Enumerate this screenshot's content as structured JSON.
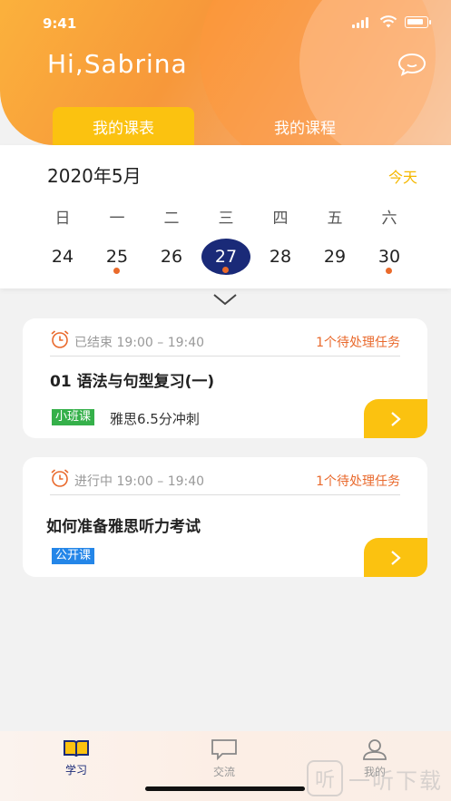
{
  "status_bar": {
    "time": "9:41"
  },
  "header": {
    "greeting": "Hi,Sabrina"
  },
  "tabs": [
    {
      "label": "我的课表",
      "active": true
    },
    {
      "label": "我的课程",
      "active": false
    }
  ],
  "calendar": {
    "month_title": "2020年5月",
    "today_label": "今天",
    "weekdays": [
      "日",
      "一",
      "二",
      "三",
      "四",
      "五",
      "六"
    ],
    "days": [
      {
        "num": "24",
        "has_dot": false,
        "selected": false
      },
      {
        "num": "25",
        "has_dot": true,
        "selected": false
      },
      {
        "num": "26",
        "has_dot": false,
        "selected": false
      },
      {
        "num": "27",
        "has_dot": true,
        "selected": true
      },
      {
        "num": "28",
        "has_dot": false,
        "selected": false
      },
      {
        "num": "29",
        "has_dot": false,
        "selected": false
      },
      {
        "num": "30",
        "has_dot": true,
        "selected": false
      }
    ]
  },
  "lessons": [
    {
      "status": "已结束 19:00 – 19:40",
      "tasks": "1个待处理任务",
      "title": "01 语法与句型复习(一)",
      "badge": "小班课",
      "course": "雅思6.5分冲刺"
    },
    {
      "status": "进行中 19:00 – 19:40",
      "tasks": "1个待处理任务",
      "title": "如何准备雅思听力考试",
      "badge": "公开课",
      "course": ""
    }
  ],
  "tabbar": [
    {
      "label": "学习",
      "icon": "book-icon",
      "active": true
    },
    {
      "label": "交流",
      "icon": "chat-icon",
      "active": false
    },
    {
      "label": "我的",
      "icon": "user-icon",
      "active": false
    }
  ],
  "watermark": {
    "glyph": "听",
    "text": "一听下载"
  },
  "colors": {
    "accent": "#fbc210",
    "selected_day": "#1a2a78",
    "dot": "#ea6a2a",
    "tasks": "#e9692c",
    "badge_small_class": "#35b04a",
    "badge_public": "#2486e8"
  }
}
